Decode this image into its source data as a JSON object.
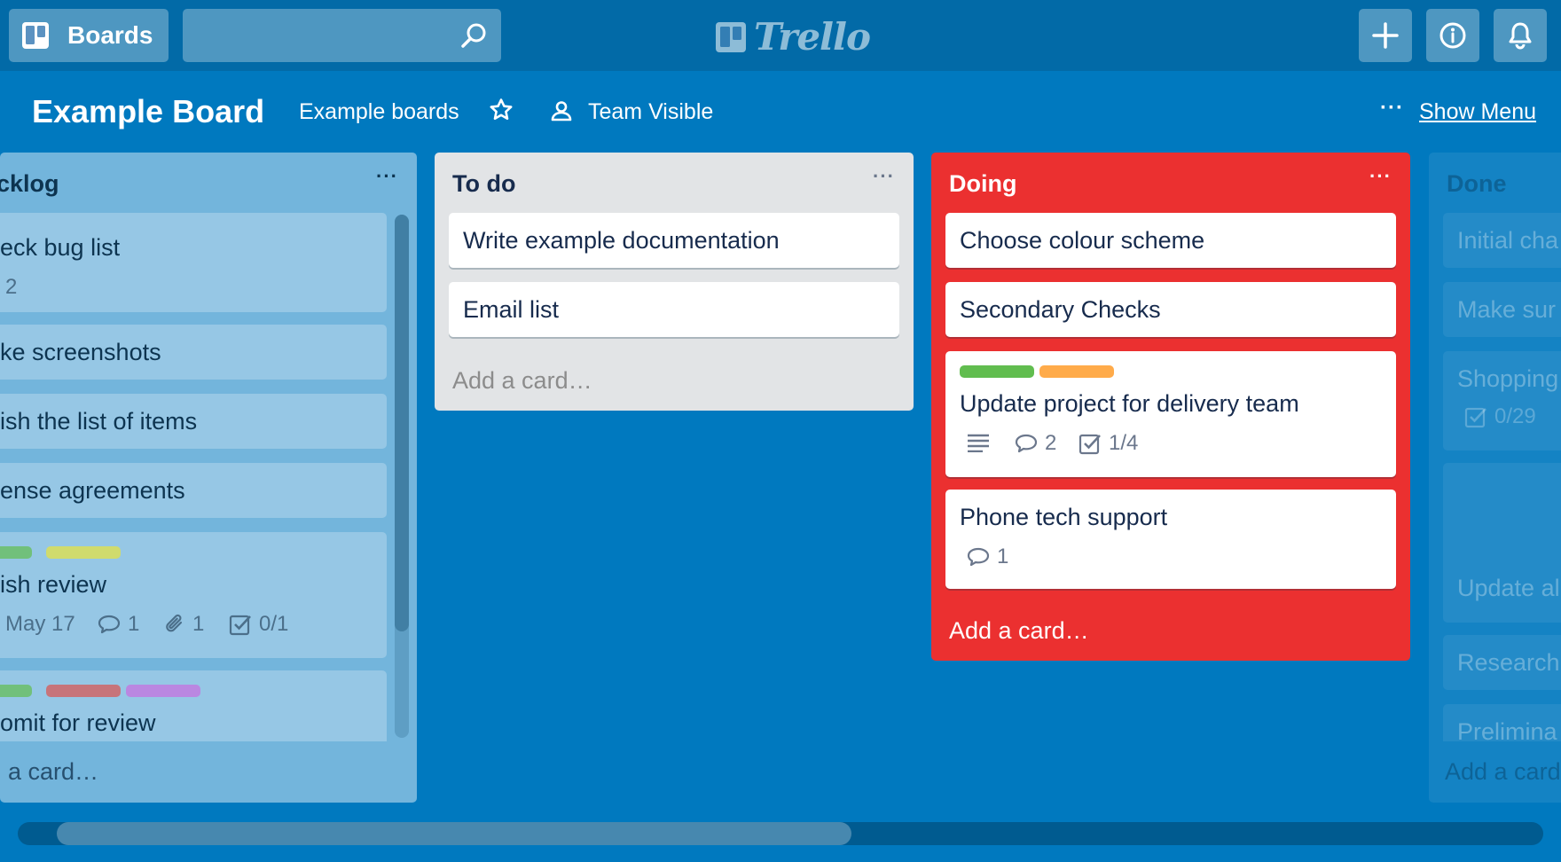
{
  "topbar": {
    "boards_label": "Boards",
    "search_placeholder": "",
    "logo_text": "Trello",
    "buttons": [
      "plus-icon",
      "info-icon",
      "bell-icon"
    ]
  },
  "board": {
    "title": "Example Board",
    "team_link": "Example boards",
    "visibility": "Team Visible",
    "show_menu": "Show Menu",
    "menu_dots": "···"
  },
  "lists": {
    "backlog": {
      "title": "cklog",
      "cards": [
        {
          "title": "eck bug list",
          "badge": "2"
        },
        {
          "title": "ke screenshots"
        },
        {
          "title": "ish the list of items"
        },
        {
          "title": "ense agreements"
        },
        {
          "title": "ish review",
          "labels": [
            "#61bd4f",
            "#dfe04f"
          ],
          "due": "May 17",
          "comments": "1",
          "attachments": "1",
          "checklist": "0/1"
        },
        {
          "title": "omit for review",
          "labels": [
            "#61bd4f",
            "#d35f5f",
            "#c377e0"
          ]
        }
      ],
      "add_card": "a card…"
    },
    "todo": {
      "title": "To do",
      "cards": [
        {
          "title": "Write example documentation"
        },
        {
          "title": "Email list"
        }
      ],
      "add_card": "Add a card…"
    },
    "doing": {
      "title": "Doing",
      "color": "#eb3030",
      "cards": [
        {
          "title": "Choose colour scheme"
        },
        {
          "title": "Secondary Checks"
        },
        {
          "title": "Update project for delivery team",
          "labels": [
            "#61bd4f",
            "#ffab4a"
          ],
          "comments": "2",
          "checklist": "1/4"
        },
        {
          "title": "Phone tech support",
          "comments": "1"
        }
      ],
      "add_card": "Add a card…"
    },
    "done": {
      "title": "Done",
      "cards": [
        {
          "title": "Initial cha"
        },
        {
          "title": "Make sur"
        },
        {
          "title": "Shopping",
          "checklist": "0/29"
        },
        {
          "title": "Update al"
        },
        {
          "title": "Research"
        },
        {
          "title": "Prelimina"
        }
      ],
      "add_card": "Add a card"
    }
  }
}
